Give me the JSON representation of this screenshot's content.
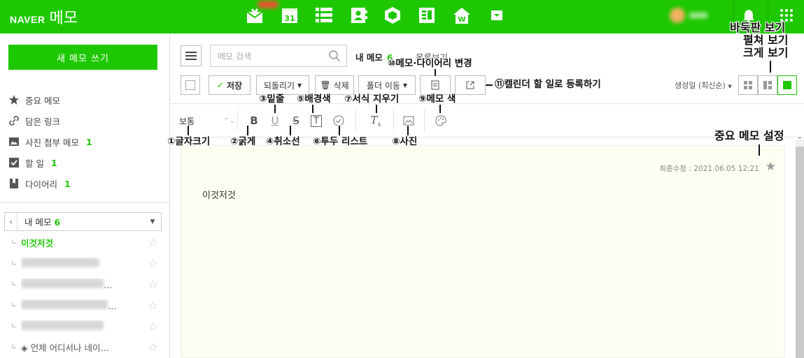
{
  "app": {
    "brand": "NAVER",
    "title": "메모"
  },
  "sidebar": {
    "new_memo_label": "새 메모 쓰기",
    "items": [
      {
        "icon": "star-icon",
        "label": "중요 메모",
        "count": ""
      },
      {
        "icon": "link-icon",
        "label": "담은 링크",
        "count": ""
      },
      {
        "icon": "photo-icon",
        "label": "사진 첨부 메모",
        "count": "1"
      },
      {
        "icon": "checkbox-icon",
        "label": "할 일",
        "count": "1"
      },
      {
        "icon": "bookmark-icon",
        "label": "다이어리",
        "count": "1"
      }
    ],
    "folder": {
      "label": "내 메모",
      "count": "6"
    },
    "memos": [
      {
        "title": "이것저것",
        "active": true
      },
      {
        "title": "",
        "active": false
      },
      {
        "title": "…",
        "active": false
      },
      {
        "title": "…",
        "active": false
      },
      {
        "title": "",
        "active": false
      },
      {
        "title": "◈ 언제 어디서나 네이…",
        "active": false
      }
    ]
  },
  "toolbar": {
    "search_placeholder": "메모 검색",
    "my_memo_label": "내 메모",
    "my_memo_count": "6",
    "list_view_label": "목록보기",
    "save_label": "저장",
    "undo_label": "되돌리기",
    "delete_label": "삭제",
    "move_folder_label": "폴더 이동",
    "sort_label": "생성일 (최신순)",
    "font_size_value": "보통"
  },
  "memo": {
    "modified": "최종수정 : 2021.06.05 12:21",
    "content": "이것저것"
  },
  "annotations": {
    "font_size": "①글자크기",
    "bold": "②굵게",
    "underline": "③밑줄",
    "strike": "④취소선",
    "bg_color": "⑤배경색",
    "todo": "⑥투두 리스트",
    "clear_format": "⑦서식 지우기",
    "photo": "⑧사진",
    "memo_color": "⑨메모 색",
    "change_to_diary": "⑩메모·다이어리 변경",
    "register_calendar": "⑪캘린더 할 일로 등록하기",
    "important": "중요 메모 설정",
    "view_modes": [
      "바둑판 보기",
      "펼쳐 보기",
      "크게 보기"
    ]
  },
  "colors": {
    "brand": "#1ec800"
  }
}
